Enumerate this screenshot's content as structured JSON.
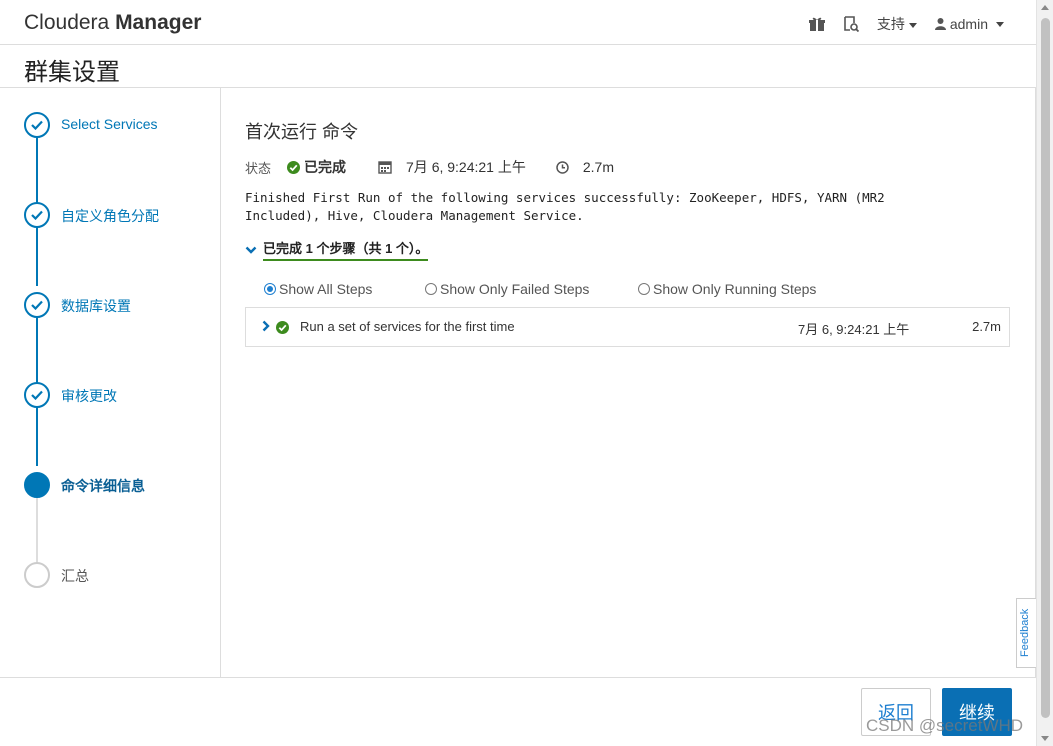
{
  "header": {
    "brand_light": "Cloudera ",
    "brand_bold": "Manager",
    "support_label": "支持",
    "user_label": "admin",
    "icons": [
      "gift-icon",
      "search-doc-icon",
      "user-icon"
    ]
  },
  "page_title": "群集设置",
  "steps": [
    {
      "label": "Select Services",
      "state": "done"
    },
    {
      "label": "自定义角色分配",
      "state": "done"
    },
    {
      "label": "数据库设置",
      "state": "done"
    },
    {
      "label": "审核更改",
      "state": "done"
    },
    {
      "label": "命令详细信息",
      "state": "active"
    },
    {
      "label": "汇总",
      "state": "pending"
    }
  ],
  "command": {
    "title": "首次运行 命令",
    "status_label": "状态",
    "status_value": "已完成",
    "start_time": "7月 6, 9:24:21 上午",
    "duration": "2.7m",
    "message": "Finished First Run of the following services successfully: ZooKeeper, HDFS, YARN (MR2 Included), Hive, Cloudera Management Service.",
    "summary": "已完成 1 个步骤（共 1 个）。"
  },
  "filters": {
    "all": "Show All Steps",
    "failed": "Show Only Failed Steps",
    "running": "Show Only Running Steps",
    "selected": "all"
  },
  "step_rows": [
    {
      "name": "Run a set of services for the first time",
      "time": "7月 6, 9:24:21 上午",
      "duration": "2.7m"
    }
  ],
  "feedback_label": "Feedback",
  "buttons": {
    "back": "返回",
    "next": "继续"
  },
  "watermark": "CSDN @secretWHD",
  "colors": {
    "accent": "#0077b6",
    "success": "#3d8b1e",
    "primary_button": "#0a6fb4"
  }
}
